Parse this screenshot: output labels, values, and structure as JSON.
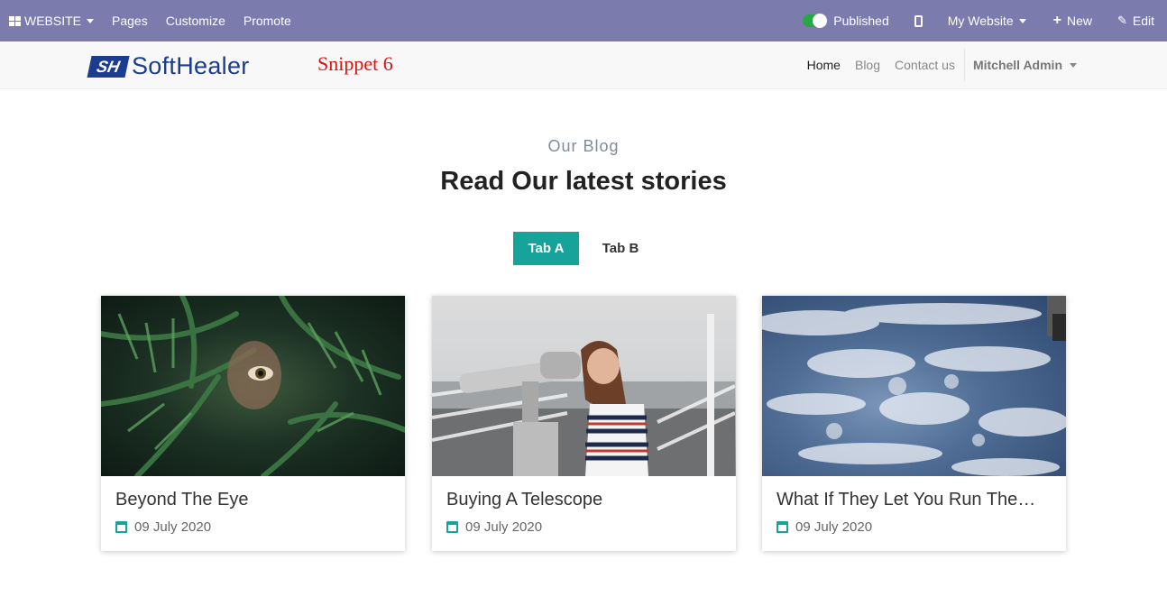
{
  "admin_bar": {
    "website_label": "WEBSITE",
    "menu": [
      "Pages",
      "Customize",
      "Promote"
    ],
    "published_label": "Published",
    "site_label": "My Website",
    "new_label": "New",
    "edit_label": "Edit"
  },
  "header": {
    "logo_mark": "SH",
    "logo_text": "SoftHealer",
    "snippet_label": "Snippet 6",
    "nav": [
      "Home",
      "Blog",
      "Contact us"
    ],
    "user": "Mitchell Admin"
  },
  "section": {
    "subheading": "Our Blog",
    "heading": "Read Our latest stories",
    "tabs": [
      "Tab A",
      "Tab B"
    ]
  },
  "posts": [
    {
      "title": "Beyond The Eye",
      "date": "09 July 2020"
    },
    {
      "title": "Buying A Telescope",
      "date": "09 July 2020"
    },
    {
      "title": "What If They Let You Run The…",
      "date": "09 July 2020"
    }
  ],
  "colors": {
    "admin_bar": "#7c7bad",
    "accent": "#16a39a",
    "snippet_label": "#e01010",
    "logo": "#1b3c8f"
  }
}
